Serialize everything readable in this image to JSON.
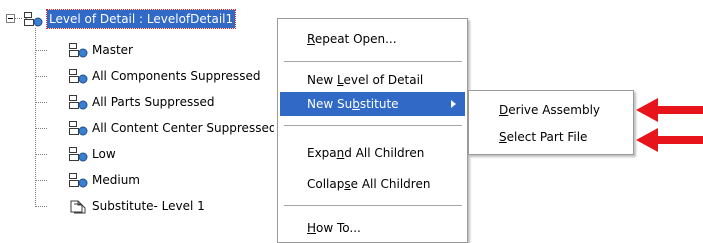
{
  "tree": {
    "root_label": "Level of Detail : LevelofDetail1",
    "items": [
      {
        "label": "Master",
        "icon": "assembly-lod-icon"
      },
      {
        "label": "All Components Suppressed",
        "icon": "assembly-lod-icon"
      },
      {
        "label": "All Parts Suppressed",
        "icon": "assembly-lod-icon"
      },
      {
        "label": "All Content Center Suppressed",
        "icon": "assembly-lod-icon"
      },
      {
        "label": "Low",
        "icon": "assembly-lod-icon"
      },
      {
        "label": "Medium",
        "icon": "assembly-lod-icon"
      },
      {
        "label": "Substitute- Level 1",
        "icon": "substitute-part-icon"
      }
    ]
  },
  "context_menu": {
    "items": [
      {
        "pre": "",
        "key": "R",
        "post": "epeat Open..."
      },
      {
        "pre": "New ",
        "key": "L",
        "post": "evel of Detail"
      },
      {
        "pre": "New Su",
        "key": "b",
        "post": "stitute"
      },
      {
        "pre": "Expa",
        "key": "n",
        "post": "d All Children"
      },
      {
        "pre": "Collap",
        "key": "s",
        "post": "e All Children"
      },
      {
        "pre": "",
        "key": "H",
        "post": "ow To..."
      }
    ]
  },
  "submenu": {
    "items": [
      {
        "pre": "",
        "key": "D",
        "post": "erive Assembly"
      },
      {
        "pre": "",
        "key": "S",
        "post": "elect Part File"
      }
    ]
  },
  "colors": {
    "highlight": "#3169c6",
    "arrow": "#e8141b"
  }
}
